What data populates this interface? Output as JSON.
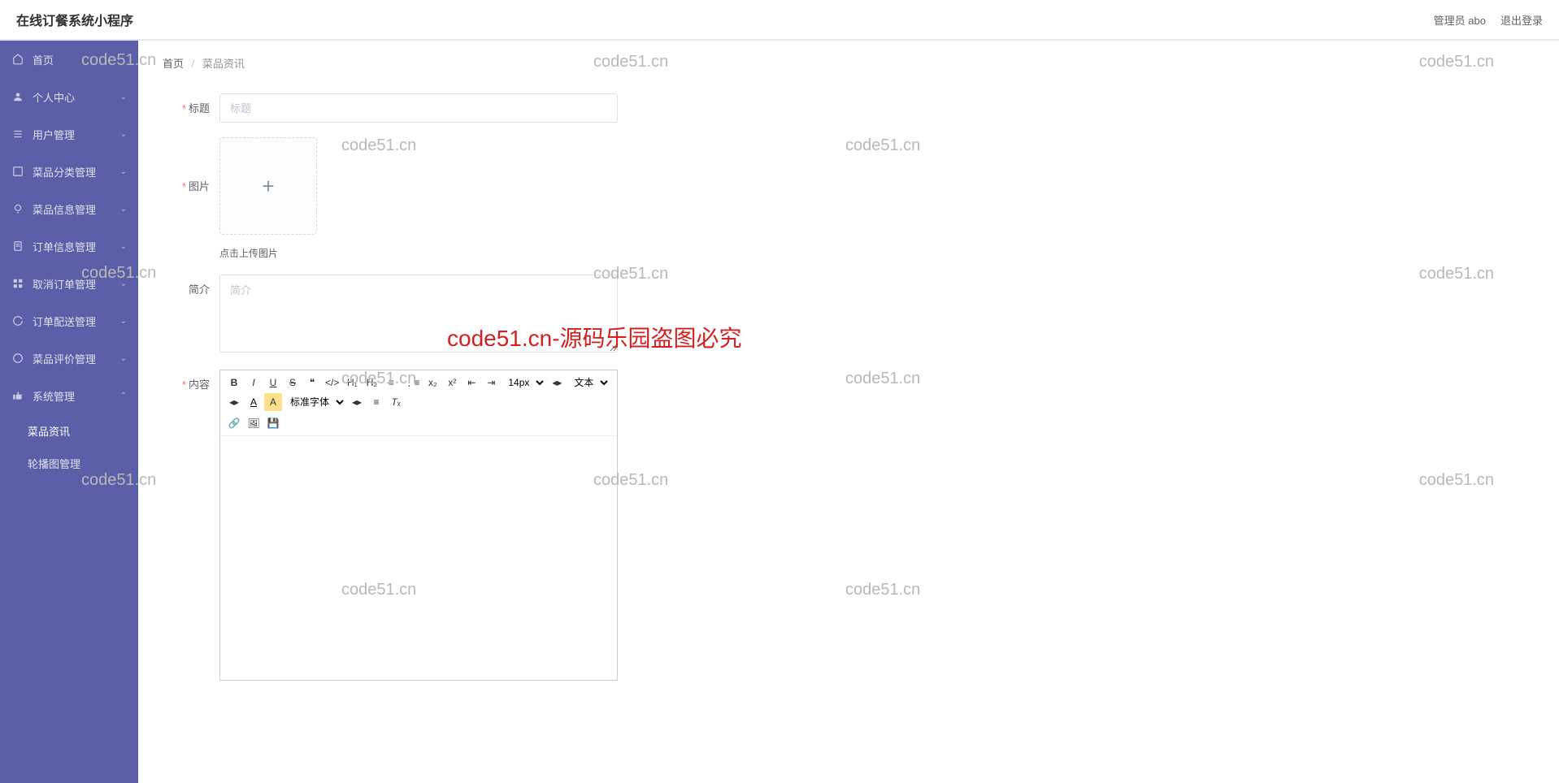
{
  "header": {
    "title": "在线订餐系统小程序",
    "adminLabel": "管理员 abo",
    "logoutLabel": "退出登录"
  },
  "sidebar": {
    "items": [
      {
        "label": "首页",
        "icon": "home"
      },
      {
        "label": "个人中心",
        "icon": "user"
      },
      {
        "label": "用户管理",
        "icon": "list"
      },
      {
        "label": "菜品分类管理",
        "icon": "category"
      },
      {
        "label": "菜品信息管理",
        "icon": "bulb"
      },
      {
        "label": "订单信息管理",
        "icon": "doc"
      },
      {
        "label": "取消订单管理",
        "icon": "grid"
      },
      {
        "label": "订单配送管理",
        "icon": "refresh"
      },
      {
        "label": "菜品评价管理",
        "icon": "star"
      },
      {
        "label": "系统管理",
        "icon": "thumb",
        "expanded": true,
        "children": [
          {
            "label": "菜品资讯",
            "active": true
          },
          {
            "label": "轮播图管理"
          }
        ]
      }
    ]
  },
  "breadcrumb": {
    "home": "首页",
    "current": "菜品资讯",
    "sep": "/"
  },
  "form": {
    "titleLabel": "标题",
    "titlePlaceholder": "标题",
    "imageLabel": "图片",
    "uploadHint": "点击上传图片",
    "summaryLabel": "简介",
    "summaryPlaceholder": "简介",
    "contentLabel": "内容"
  },
  "editorToolbar": {
    "fontSize": "14px",
    "textLabel": "文本",
    "fontFamily": "标准字体"
  },
  "watermarks": {
    "gray": "code51.cn",
    "red": "code51.cn-源码乐园盗图必究"
  }
}
